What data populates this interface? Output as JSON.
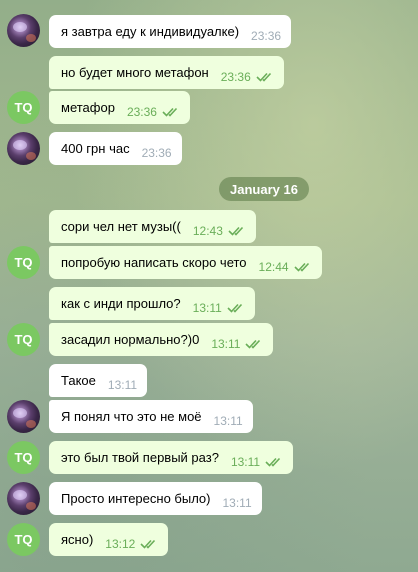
{
  "date_separator": "January 16",
  "avatars": {
    "tq_initials": "TQ"
  },
  "messages": [
    {
      "text": "я завтра еду к индивидуалке)",
      "time": "23:36"
    },
    {
      "text": "но будет много метафон",
      "time": "23:36"
    },
    {
      "text": "метафор",
      "time": "23:36"
    },
    {
      "text": "400 грн час",
      "time": "23:36"
    },
    {
      "text": "сори чел нет музы((",
      "time": "12:43"
    },
    {
      "text": "попробую написать скоро чето",
      "time": "12:44"
    },
    {
      "text": "как с инди прошло?",
      "time": "13:11"
    },
    {
      "text": "засадил нормально?)0",
      "time": "13:11"
    },
    {
      "text": "Такое",
      "time": "13:11"
    },
    {
      "text": "Я понял что это не моё",
      "time": "13:11"
    },
    {
      "text": "это был твой первый раз?",
      "time": "13:11"
    },
    {
      "text": "Просто интересно было)",
      "time": "13:11"
    },
    {
      "text": "ясно)",
      "time": "13:12"
    }
  ],
  "colors": {
    "outgoing_bubble": "#efffde",
    "incoming_bubble": "#ffffff",
    "tq_avatar": "#7bc862",
    "check_green": "#6aae59"
  }
}
